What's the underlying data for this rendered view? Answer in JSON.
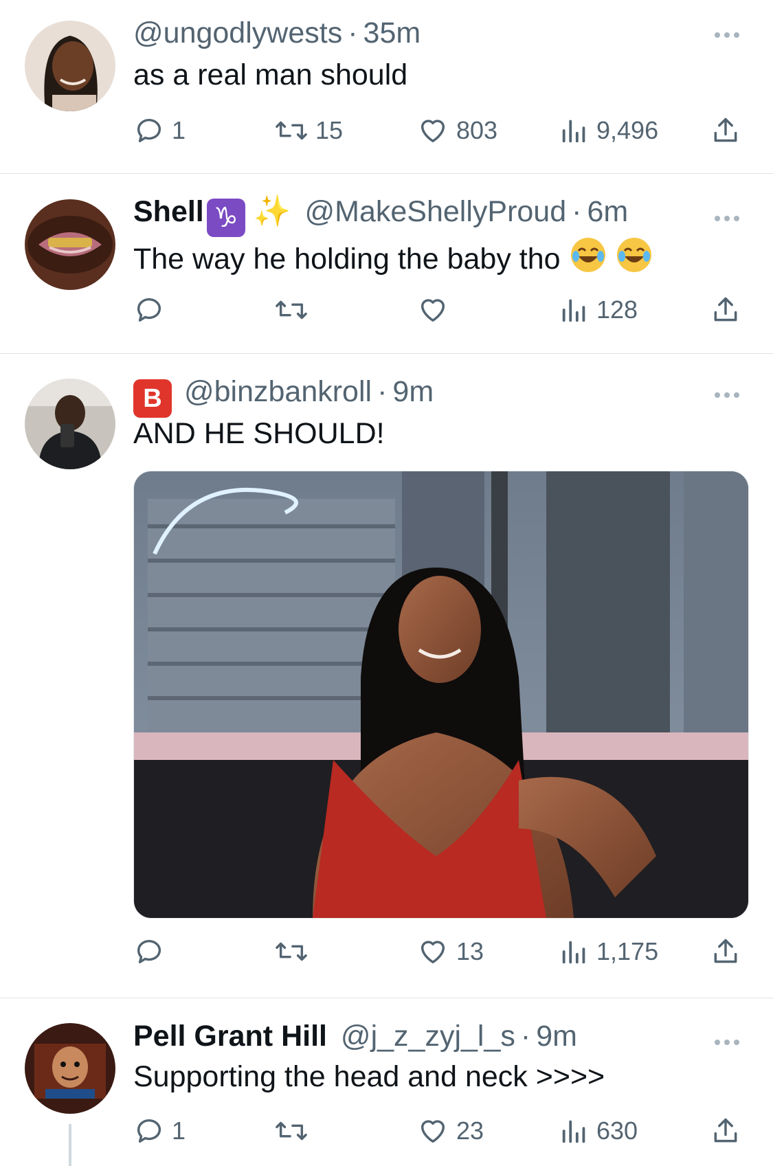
{
  "tweets": [
    {
      "name": "",
      "handle": "@ungodlywests",
      "time": "35m",
      "text": "as a real man should",
      "replies": "1",
      "retweets": "15",
      "likes": "803",
      "views": "9,496"
    },
    {
      "name": "Shell",
      "name_badges": [
        "capricorn-emoji",
        "sparkles-emoji"
      ],
      "handle": "@MakeShellyProud",
      "time": "6m",
      "text": "The way he holding the baby tho",
      "text_emojis": [
        "joy-emoji",
        "joy-emoji"
      ],
      "replies": "",
      "retweets": "",
      "likes": "",
      "views": "128"
    },
    {
      "name": "",
      "name_badges": [
        "b-button-emoji"
      ],
      "handle": "@binzbankroll",
      "time": "9m",
      "text": "AND HE SHOULD!",
      "media": "photo",
      "replies": "",
      "retweets": "",
      "likes": "13",
      "views": "1,175"
    },
    {
      "name": "Pell Grant Hill",
      "handle": "@j_z_zyj_l_s",
      "time": "9m",
      "text": "Supporting the head and neck >>>>",
      "replies": "1",
      "retweets": "",
      "likes": "23",
      "views": "630"
    }
  ],
  "separator": "·",
  "badges": {
    "capricorn": "♑",
    "b": "B",
    "sparkles": "✨"
  },
  "icons": [
    "reply-icon",
    "retweet-icon",
    "like-icon",
    "views-icon",
    "share-icon",
    "more-icon"
  ],
  "colors": {
    "text": "#0f1419",
    "secondary": "#536471",
    "divider": "#dfe3e6"
  }
}
